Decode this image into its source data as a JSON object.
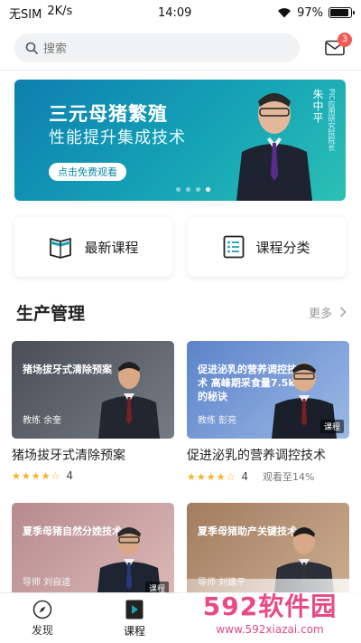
{
  "status_bar": {
    "carrier": "无SIM",
    "speed": "2K/s",
    "time": "14:09",
    "battery_percent": "97%",
    "battery_level": 0.97
  },
  "search": {
    "placeholder": "搜索"
  },
  "mail": {
    "badge_count": "3"
  },
  "banner": {
    "title": "三元母猪繁殖",
    "subtitle": "性能提升集成技术",
    "button_label": "点击免费观看",
    "speaker_name": "朱中平",
    "speaker_role": "PIC应用研究院院长",
    "dots": 4,
    "active_dot": 3
  },
  "quick_links": [
    {
      "label": "最新课程",
      "icon": "book-icon"
    },
    {
      "label": "课程分类",
      "icon": "list-icon"
    }
  ],
  "section": {
    "title": "生产管理",
    "more_label": "更多"
  },
  "courses": [
    {
      "image_caption": "猪场拔牙式清除预案",
      "teacher": "教练 余奎",
      "title": "猪场拔牙式清除预案",
      "rating": "4",
      "progress": "",
      "tag": "",
      "colors": [
        "#4a4f57",
        "#757b84"
      ]
    },
    {
      "image_caption": "促进泌乳的营养调控技术 高峰期采食量7.5kg的秘诀",
      "teacher": "教练 彭亮",
      "title": "促进泌乳的营养调控技术",
      "rating": "4",
      "progress": "观看至14%",
      "tag": "课程",
      "colors": [
        "#5c84c9",
        "#9cb8e6"
      ]
    },
    {
      "image_caption": "夏季母猪自然分娩技术",
      "teacher": "导师 刘自逵",
      "title": "",
      "rating": "",
      "progress": "",
      "tag": "课程",
      "colors": [
        "#b78a8e",
        "#dcbab8"
      ]
    },
    {
      "image_caption": "夏季母猪助产关键技术",
      "teacher": "导师 刘建平",
      "title": "",
      "rating": "",
      "progress": "",
      "tag": "",
      "colors": [
        "#a27c5f",
        "#ccae92"
      ]
    }
  ],
  "tabs": [
    {
      "label": "发现",
      "icon": "compass-icon",
      "active": false
    },
    {
      "label": "课程",
      "icon": "play-icon",
      "active": true
    }
  ],
  "watermark": {
    "main": "592软件园",
    "url": "www.592xiazai.com"
  },
  "colors": {
    "accent": "#1aa3b5",
    "badge": "#f25c54",
    "star": "#f5b21c"
  }
}
